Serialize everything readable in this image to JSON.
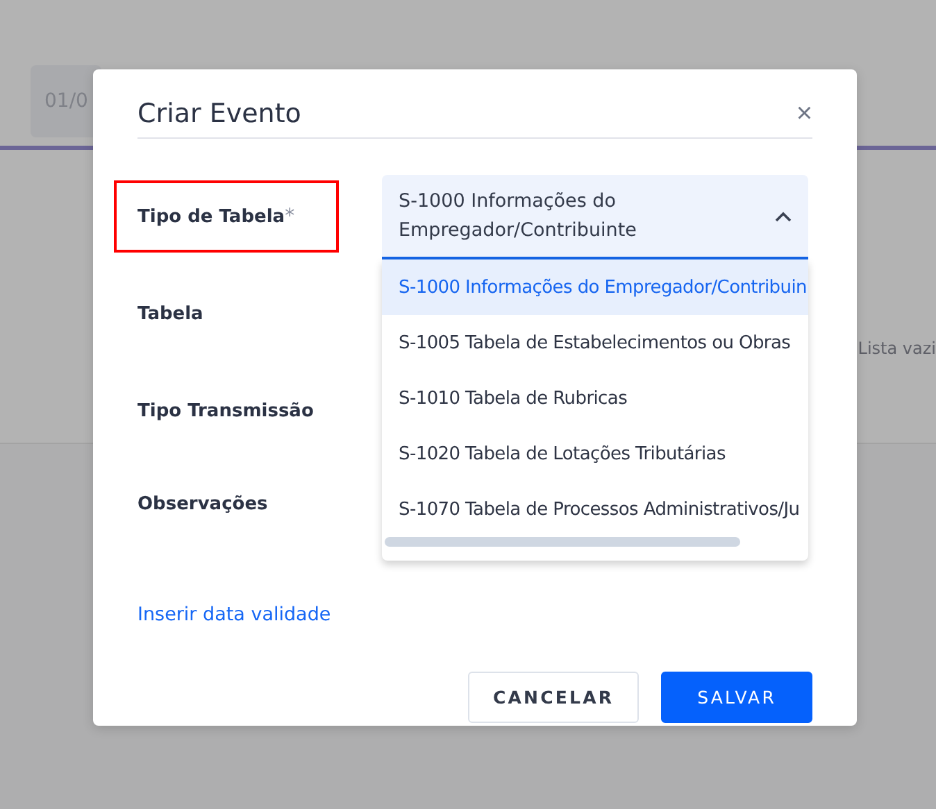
{
  "background": {
    "date_chip": "01/0",
    "empty_text": "Lista vazi"
  },
  "dialog": {
    "title": "Criar Evento",
    "close": "×",
    "fields": [
      {
        "label": "Tipo de Tabela",
        "required_mark": "*",
        "highlighted": true
      },
      {
        "label": "Tabela",
        "highlighted": false
      },
      {
        "label": "Tipo Transmissão",
        "highlighted": false
      },
      {
        "label": "Observações",
        "highlighted": false
      }
    ],
    "select": {
      "value": "S-1000 Informações do Empregador/Contribuinte",
      "expanded": true,
      "options": [
        {
          "label": "S-1000 Informações do Empregador/Contribuin",
          "selected": true
        },
        {
          "label": "S-1005 Tabela de Estabelecimentos ou Obras",
          "selected": false
        },
        {
          "label": "S-1010 Tabela de Rubricas",
          "selected": false
        },
        {
          "label": "S-1020 Tabela de Lotações Tributárias",
          "selected": false
        },
        {
          "label": "S-1070 Tabela de Processos Administrativos/Ju",
          "selected": false
        }
      ]
    },
    "link": "Inserir data validade",
    "buttons": [
      {
        "label": "CANCELAR",
        "kind": "secondary"
      },
      {
        "label": "SALVAR",
        "kind": "primary"
      }
    ]
  }
}
